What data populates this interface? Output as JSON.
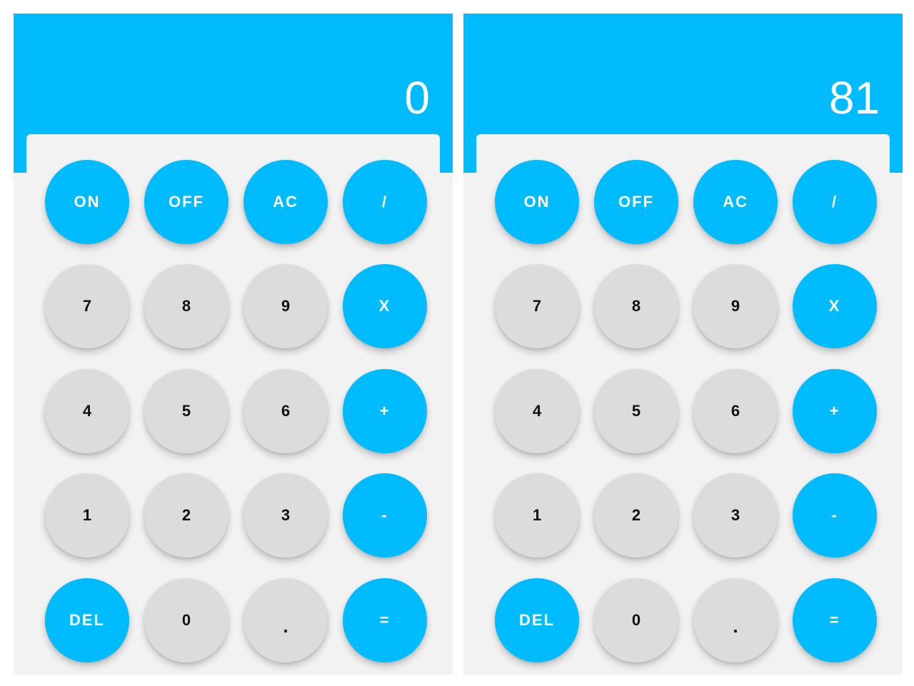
{
  "screens": [
    {
      "display": "0",
      "keys": [
        [
          "ON",
          "OFF",
          "AC",
          "/"
        ],
        [
          "7",
          "8",
          "9",
          "X"
        ],
        [
          "4",
          "5",
          "6",
          "+"
        ],
        [
          "1",
          "2",
          "3",
          "-"
        ],
        [
          "DEL",
          "0",
          ".",
          "="
        ]
      ]
    },
    {
      "display": "81",
      "keys": [
        [
          "ON",
          "OFF",
          "AC",
          "/"
        ],
        [
          "7",
          "8",
          "9",
          "X"
        ],
        [
          "4",
          "5",
          "6",
          "+"
        ],
        [
          "1",
          "2",
          "3",
          "-"
        ],
        [
          "DEL",
          "0",
          ".",
          "="
        ]
      ]
    }
  ],
  "colors": {
    "accent": "#00bbfd",
    "number_key": "#dcdcdc",
    "background": "#f2f2f2"
  }
}
